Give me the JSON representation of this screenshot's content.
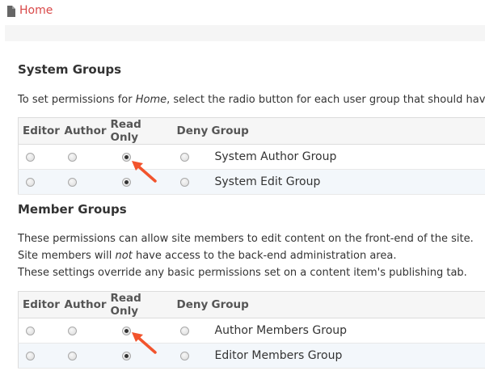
{
  "breadcrumb": {
    "home_label": "Home"
  },
  "system_groups": {
    "title": "System Groups",
    "description_prefix": "To set permissions for ",
    "description_page": "Home",
    "description_suffix": ", select the radio button for each user group that should have",
    "columns": [
      "Editor",
      "Author",
      "Read Only",
      "Deny",
      "Group"
    ],
    "rows": [
      {
        "group": "System Author Group",
        "selected": "Read Only"
      },
      {
        "group": "System Edit Group",
        "selected": "Read Only"
      }
    ]
  },
  "member_groups": {
    "title": "Member Groups",
    "line1": "These permissions can allow site members to edit content on the front-end of the site.",
    "line2_prefix": "Site members will ",
    "line2_emph": "not",
    "line2_suffix": " have access to the back-end administration area.",
    "line3": "These settings override any basic permissions set on a content item's publishing tab.",
    "columns": [
      "Editor",
      "Author",
      "Read Only",
      "Deny",
      "Group"
    ],
    "rows": [
      {
        "group": "Author Members Group",
        "selected": "Read Only"
      },
      {
        "group": "Editor Members Group",
        "selected": "Read Only"
      }
    ]
  },
  "annotation_color": "#f2542d",
  "icons": {
    "breadcrumb": "document-icon",
    "annotation": "red-arrow-icon"
  }
}
